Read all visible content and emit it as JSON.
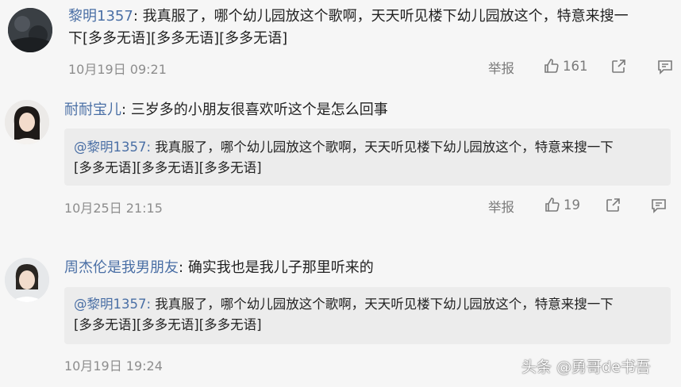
{
  "comments": [
    {
      "username": "黎明1357",
      "separator": ":",
      "text_line1": "我真服了，哪个幼儿园放这个歌啊，天天听见楼下幼儿园放这个，特意来搜一",
      "text_line2": "下[多多无语][多多无语][多多无语]",
      "date": "10月19日 09:21",
      "report_label": "举报",
      "like_count": "161"
    },
    {
      "username": "耐耐宝儿",
      "separator": ":",
      "text": "三岁多的小朋友很喜欢听这个是怎么回事",
      "quote_user": "@黎明1357:",
      "quote_line1": " 我真服了，哪个幼儿园放这个歌啊，天天听见楼下幼儿园放这个，特意来搜一下",
      "quote_line2": "[多多无语][多多无语][多多无语]",
      "date": "10月25日 21:15",
      "report_label": "举报",
      "like_count": "19"
    },
    {
      "username": "周杰伦是我男朋友",
      "separator": ":",
      "text": "确实我也是我儿子那里听来的",
      "quote_user": "@黎明1357:",
      "quote_line1": " 我真服了，哪个幼儿园放这个歌啊，天天听见楼下幼儿园放这个，特意来搜一下",
      "quote_line2": "[多多无语][多多无语][多多无语]",
      "date": "10月19日 19:24"
    }
  ],
  "watermark": "头条 @勇哥de书吾",
  "icons": [
    "thumb-up-icon",
    "share-icon",
    "comment-icon"
  ],
  "colors": {
    "username": "#4a6fa5",
    "background": "#f6f6f6",
    "quote_bg": "#ececec",
    "meta": "#8d8d8d"
  }
}
